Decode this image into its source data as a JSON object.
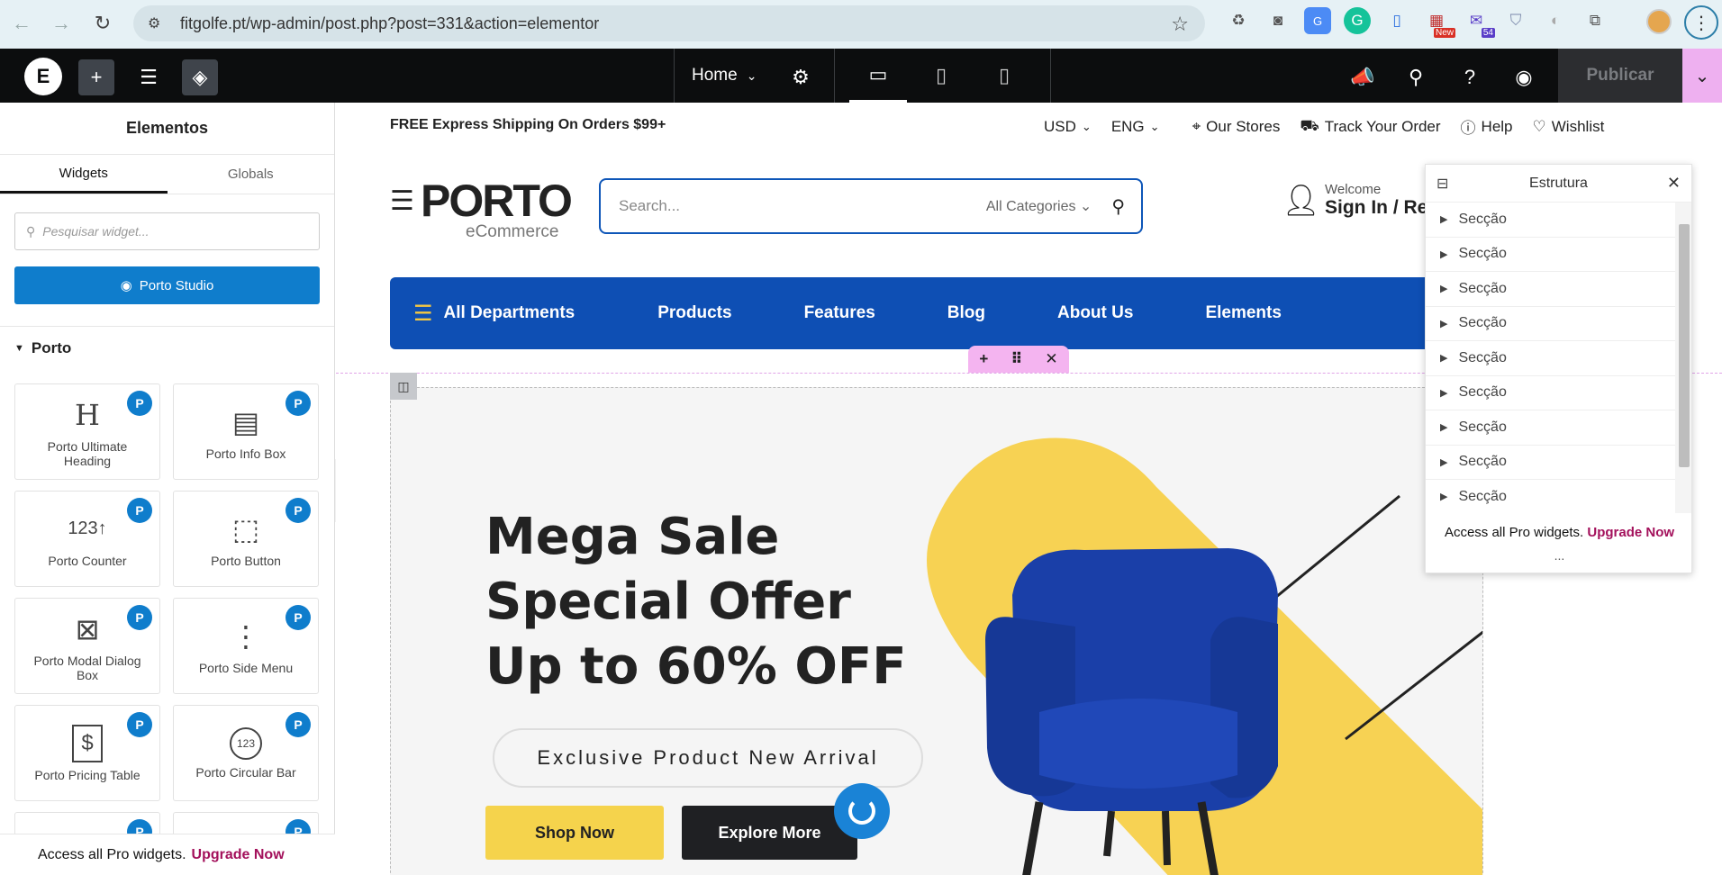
{
  "browser": {
    "url": "fitgolfe.pt/wp-admin/post.php?post=331&action=elementor"
  },
  "editor": {
    "page_name": "Home",
    "publish_label": "Publicar"
  },
  "left_panel": {
    "title": "Elementos",
    "tabs": [
      "Widgets",
      "Globals"
    ],
    "search_placeholder": "Pesquisar widget...",
    "studio_label": "Porto Studio",
    "category": "Porto",
    "widgets": [
      {
        "label": "Porto Ultimate Heading",
        "icon": "H"
      },
      {
        "label": "Porto Info Box",
        "icon": "▤"
      },
      {
        "label": "Porto Counter",
        "icon": "123↑"
      },
      {
        "label": "Porto Button",
        "icon": "⬚"
      },
      {
        "label": "Porto Modal Dialog Box",
        "icon": "⊠"
      },
      {
        "label": "Porto Side Menu",
        "icon": "⋮"
      },
      {
        "label": "Porto Pricing Table",
        "icon": "$"
      },
      {
        "label": "Porto Circular Bar",
        "icon": "123"
      }
    ],
    "badge": "P",
    "footer_text": "Access all Pro widgets.",
    "footer_link": "Upgrade Now"
  },
  "site": {
    "shipping_text": "FREE Express Shipping On Orders $99+",
    "currency": "USD",
    "language": "ENG",
    "links": [
      "Our Stores",
      "Track Your Order",
      "Help",
      "Wishlist"
    ],
    "logo_main": "PORTO",
    "logo_sub": "eCommerce",
    "search_placeholder": "Search...",
    "search_category": "All Categories",
    "welcome": "Welcome",
    "sign_in": "Sign In / Re",
    "nav": {
      "departments": "All Departments",
      "items": [
        "Products",
        "Features",
        "Blog",
        "About Us",
        "Elements"
      ]
    },
    "hero": {
      "title_lines": [
        "Mega Sale",
        "Special Offer",
        "Up to 60% OFF"
      ],
      "badge": "Exclusive Product New Arrival",
      "primary_button": "Shop Now",
      "secondary_button": "Explore More"
    }
  },
  "structure_panel": {
    "title": "Estrutura",
    "items": [
      "Secção",
      "Secção",
      "Secção",
      "Secção",
      "Secção",
      "Secção",
      "Secção",
      "Secção",
      "Secção"
    ],
    "footer_text": "Access all Pro widgets.",
    "footer_link": "Upgrade Now",
    "more": "..."
  },
  "colors": {
    "elementor_dark": "#0c0d0e",
    "porto_blue": "#0e4fb4",
    "studio_blue": "#0f7dcc",
    "yellow": "#f5d34c",
    "upgrade_link": "#a3105b",
    "chair_blue": "#1a3fa8"
  }
}
